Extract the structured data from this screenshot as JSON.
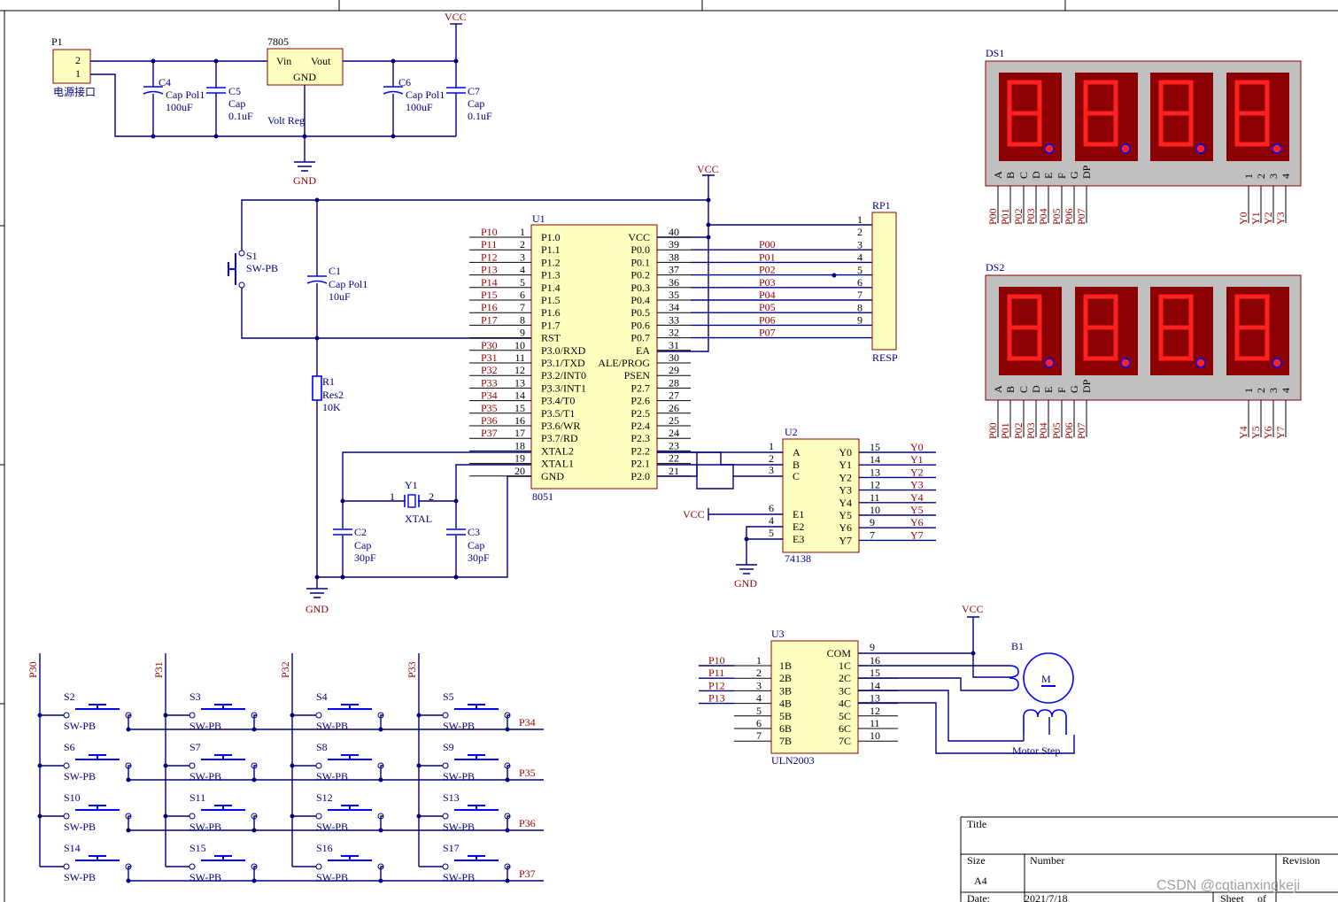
{
  "power": {
    "p1": {
      "ref": "P1",
      "pin2": "2",
      "pin1": "1",
      "desc": "电源接口"
    },
    "c4": {
      "ref": "C4",
      "type": "Cap Pol1",
      "value": "100uF"
    },
    "c5": {
      "ref": "C5",
      "type": "Cap",
      "value": "0.1uF"
    },
    "reg": {
      "ref": "7805",
      "vin": "Vin",
      "vout": "Vout",
      "gnd": "GND",
      "desc": "Volt Reg"
    },
    "c6": {
      "ref": "C6",
      "type": "Cap Pol1",
      "value": "100uF"
    },
    "c7": {
      "ref": "C7",
      "type": "Cap",
      "value": "0.1uF"
    },
    "vcc": "VCC",
    "gnd": "GND"
  },
  "reset": {
    "s1": {
      "ref": "S1",
      "type": "SW-PB"
    },
    "c1": {
      "ref": "C1",
      "type": "Cap Pol1",
      "value": "10uF"
    },
    "r1": {
      "ref": "R1",
      "type": "Res2",
      "value": "10K"
    },
    "vcc": "VCC",
    "gnd": "GND"
  },
  "mcu": {
    "ref": "U1",
    "type": "8051",
    "left_nets": [
      "P10",
      "P11",
      "P12",
      "P13",
      "P14",
      "P15",
      "P16",
      "P17",
      "",
      "P30",
      "P31",
      "P32",
      "P33",
      "P34",
      "P35",
      "P36",
      "P37",
      "",
      "",
      ""
    ],
    "left_nums": [
      "1",
      "2",
      "3",
      "4",
      "5",
      "6",
      "7",
      "8",
      "9",
      "10",
      "11",
      "12",
      "13",
      "14",
      "15",
      "16",
      "17",
      "18",
      "19",
      "20"
    ],
    "left_names": [
      "P1.0",
      "P1.1",
      "P1.2",
      "P1.3",
      "P1.4",
      "P1.5",
      "P1.6",
      "P1.7",
      "RST",
      "P3.0/RXD",
      "P3.1/TXD",
      "P3.2/INT0",
      "P3.3/INT1",
      "P3.4/T0",
      "P3.5/T1",
      "P3.6/WR",
      "P3.7/RD",
      "XTAL2",
      "XTAL1",
      "GND"
    ],
    "right_names": [
      "VCC",
      "P0.0",
      "P0.1",
      "P0.2",
      "P0.3",
      "P0.4",
      "P0.5",
      "P0.6",
      "P0.7",
      "EA",
      "ALE/PROG",
      "PSEN",
      "P2.7",
      "P2.6",
      "P2.5",
      "P2.4",
      "P2.3",
      "P2.2",
      "P2.1",
      "P2.0"
    ],
    "right_nums": [
      "40",
      "39",
      "38",
      "37",
      "36",
      "35",
      "34",
      "33",
      "32",
      "31",
      "30",
      "29",
      "28",
      "27",
      "26",
      "25",
      "24",
      "23",
      "22",
      "21"
    ],
    "p0_nets": [
      "P00",
      "P01",
      "P02",
      "P03",
      "P04",
      "P05",
      "P06",
      "P07"
    ]
  },
  "crystal": {
    "y1": {
      "ref": "Y1",
      "type": "XTAL",
      "pin1": "1",
      "pin2": "2"
    },
    "c2": {
      "ref": "C2",
      "type": "Cap",
      "value": "30pF"
    },
    "c3": {
      "ref": "C3",
      "type": "Cap",
      "value": "30pF"
    }
  },
  "rp1": {
    "ref": "RP1",
    "type": "RESP",
    "pins": [
      "1",
      "2",
      "3",
      "4",
      "5",
      "6",
      "7",
      "8",
      "9"
    ]
  },
  "u2": {
    "ref": "U2",
    "type": "74138",
    "in_nums": [
      "1",
      "2",
      "3"
    ],
    "in_names": [
      "A",
      "B",
      "C"
    ],
    "en_nums": [
      "6",
      "4",
      "5"
    ],
    "en_names": [
      "E1",
      "E2",
      "E3"
    ],
    "out_names": [
      "Y0",
      "Y1",
      "Y2",
      "Y3",
      "Y4",
      "Y5",
      "Y6",
      "Y7"
    ],
    "out_nums": [
      "15",
      "14",
      "13",
      "12",
      "11",
      "10",
      "9",
      "7"
    ],
    "out_nets": [
      "Y0",
      "Y1",
      "Y2",
      "Y3",
      "Y4",
      "Y5",
      "Y6",
      "Y7"
    ],
    "vcc": "VCC",
    "gnd": "GND"
  },
  "ds1": {
    "ref": "DS1",
    "seg_labels": [
      "A",
      "B",
      "C",
      "D",
      "E",
      "F",
      "G",
      "DP"
    ],
    "com_labels": [
      "1",
      "2",
      "3",
      "4"
    ],
    "seg_nets": [
      "P00",
      "P01",
      "P02",
      "P03",
      "P04",
      "P05",
      "P06",
      "P07"
    ],
    "com_nets": [
      "Y0",
      "Y1",
      "Y2",
      "Y3"
    ]
  },
  "ds2": {
    "ref": "DS2",
    "seg_labels": [
      "A",
      "B",
      "C",
      "D",
      "E",
      "F",
      "G",
      "DP"
    ],
    "com_labels": [
      "1",
      "2",
      "3",
      "4"
    ],
    "seg_nets": [
      "P00",
      "P01",
      "P02",
      "P03",
      "P04",
      "P05",
      "P06",
      "P07"
    ],
    "com_nets": [
      "Y4",
      "Y5",
      "Y6",
      "Y7"
    ]
  },
  "u3": {
    "ref": "U3",
    "type": "ULN2003",
    "in_nets": [
      "P10",
      "P11",
      "P12",
      "P13",
      "",
      "",
      ""
    ],
    "in_nums": [
      "1",
      "2",
      "3",
      "4",
      "5",
      "6",
      "7"
    ],
    "in_names": [
      "1B",
      "2B",
      "3B",
      "4B",
      "5B",
      "6B",
      "7B"
    ],
    "com": "COM",
    "com_num": "9",
    "out_names": [
      "1C",
      "2C",
      "3C",
      "4C",
      "5C",
      "6C",
      "7C"
    ],
    "out_nums": [
      "16",
      "15",
      "14",
      "13",
      "12",
      "11",
      "10"
    ],
    "vcc": "VCC"
  },
  "motor": {
    "ref": "B1",
    "type": "Motor Step",
    "symbol": "M"
  },
  "keypad": {
    "col_nets": [
      "P30",
      "P31",
      "P32",
      "P33"
    ],
    "row_nets": [
      "P34",
      "P35",
      "P36",
      "P37"
    ],
    "keys": [
      [
        "S2",
        "S3",
        "S4",
        "S5"
      ],
      [
        "S6",
        "S7",
        "S8",
        "S9"
      ],
      [
        "S10",
        "S11",
        "S12",
        "S13"
      ],
      [
        "S14",
        "S15",
        "S16",
        "S17"
      ]
    ],
    "key_type": "SW-PB"
  },
  "title_block": {
    "title": "Title",
    "size": "Size",
    "size_value": "A4",
    "number": "Number",
    "revision": "Revision",
    "date": "Date:",
    "date_value": "2021/7/18",
    "sheet": "Sheet",
    "of": "of"
  },
  "watermark": "CSDN @cqtianxingkeji"
}
